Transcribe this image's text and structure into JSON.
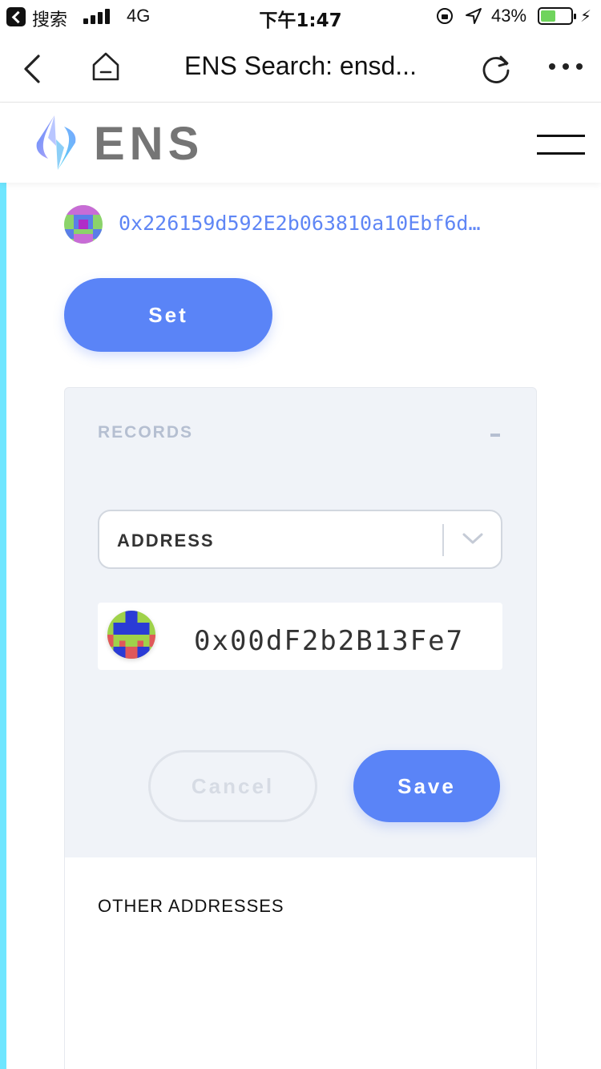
{
  "status_bar": {
    "app_name": "搜索",
    "network": "4G",
    "time": "下午1:47",
    "battery_percent": "43%",
    "battery_level": 0.43
  },
  "nav": {
    "title": "ENS Search: ensd..."
  },
  "ens_header": {
    "logo_text": "ENS"
  },
  "owner": {
    "address": "0x226159d592E2b063810a10Ebf6d…",
    "set_label": "Set"
  },
  "records": {
    "title": "RECORDS",
    "toggle": "-",
    "select_value": "ADDRESS",
    "address_value": "0x00dF2b2B13Fe7",
    "cancel_label": "Cancel",
    "save_label": "Save"
  },
  "other_addresses": {
    "title": "OTHER ADDRESSES"
  },
  "colors": {
    "accent": "#5a84f7",
    "left_bar": "#6fe6ff",
    "address_link": "#5f86f5",
    "card_bg": "#f0f3f8"
  }
}
